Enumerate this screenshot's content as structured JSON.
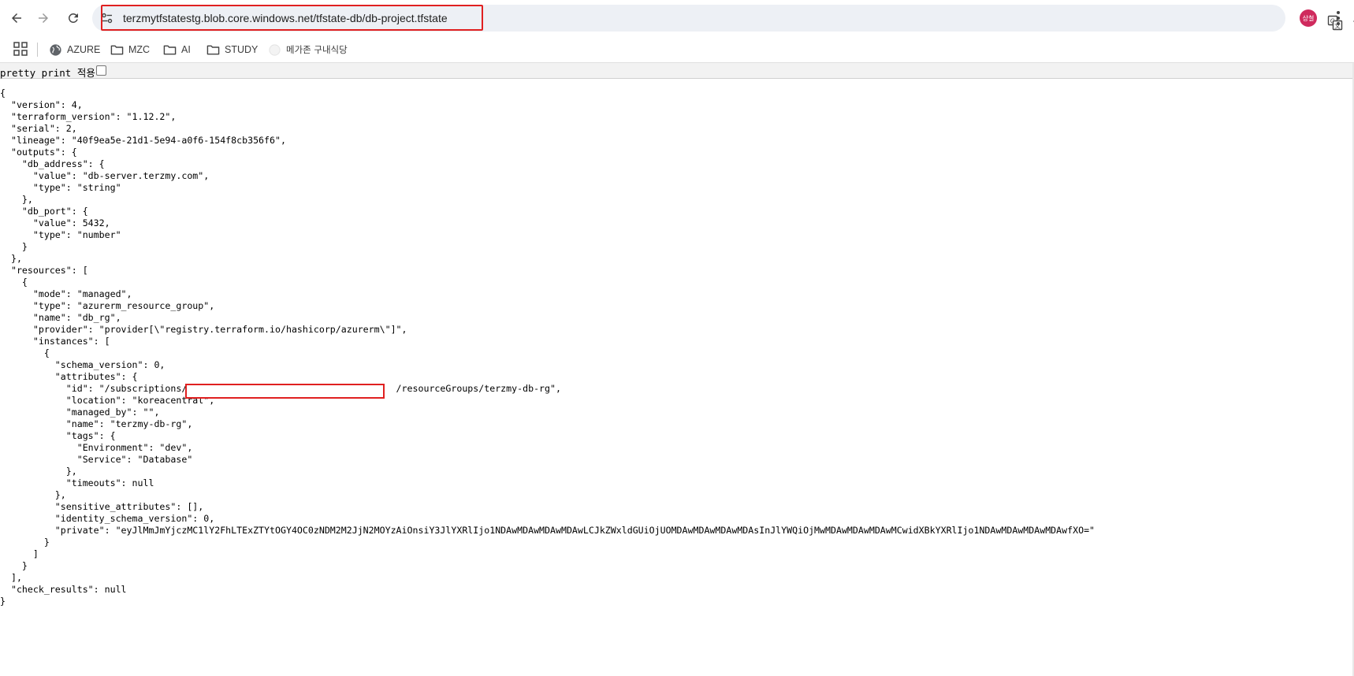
{
  "browser": {
    "url": "terzmytfstatestg.blob.core.windows.net/tfstate-db/db-project.tfstate",
    "avatar_text": "상철",
    "icons": {
      "back": "back-arrow-icon",
      "forward": "forward-arrow-icon",
      "reload": "reload-icon",
      "site_info": "tune-icon",
      "translate": "translate-icon",
      "bookmark": "star-icon",
      "menu": "kebab-menu-icon"
    }
  },
  "bookmarks": {
    "apps_icon": "apps-grid-icon",
    "items": [
      {
        "label": "AZURE",
        "icon": "globe-icon"
      },
      {
        "label": "MZC",
        "icon": "folder-icon"
      },
      {
        "label": "AI",
        "icon": "folder-icon"
      },
      {
        "label": "STUDY",
        "icon": "folder-icon"
      },
      {
        "label": "메가존 구내식당",
        "icon": "globe-icon"
      }
    ]
  },
  "viewer": {
    "pretty_print_label": "pretty print 적용",
    "pretty_print_checked": false
  },
  "json_lines": [
    "{",
    "  \"version\": 4,",
    "  \"terraform_version\": \"1.12.2\",",
    "  \"serial\": 2,",
    "  \"lineage\": \"40f9ea5e-21d1-5e94-a0f6-154f8cb356f6\",",
    "  \"outputs\": {",
    "    \"db_address\": {",
    "      \"value\": \"db-server.terzmy.com\",",
    "      \"type\": \"string\"",
    "    },",
    "    \"db_port\": {",
    "      \"value\": 5432,",
    "      \"type\": \"number\"",
    "    }",
    "  },",
    "  \"resources\": [",
    "    {",
    "      \"mode\": \"managed\",",
    "      \"type\": \"azurerm_resource_group\",",
    "      \"name\": \"db_rg\",",
    "      \"provider\": \"provider[\\\"registry.terraform.io/hashicorp/azurerm\\\"]\",",
    "      \"instances\": [",
    "        {",
    "          \"schema_version\": 0,",
    "          \"attributes\": {",
    "            \"id\": \"/subscriptions/                                      /resourceGroups/terzmy-db-rg\",",
    "            \"location\": \"koreacentral\",",
    "            \"managed_by\": \"\",",
    "            \"name\": \"terzmy-db-rg\",",
    "            \"tags\": {",
    "              \"Environment\": \"dev\",",
    "              \"Service\": \"Database\"",
    "            },",
    "            \"timeouts\": null",
    "          },",
    "          \"sensitive_attributes\": [],",
    "          \"identity_schema_version\": 0,",
    "          \"private\": \"eyJlMmJmYjczMC1lY2FhLTExZTYtOGY4OC0zNDM2M2JjN2MOYzAiOnsiY3JlYXRlIjo1NDAwMDAwMDAwMDAwLCJkZWxldGUiOjUOMDAwMDAwMDAwMDAsInJlYWQiOjMwMDAwMDAwMDAwMCwidXBkYXRlIjo1NDAwMDAwMDAwMDAwfXO=\"",
    "        }",
    "      ]",
    "    }",
    "  ],",
    "  \"check_results\": null",
    "}"
  ]
}
